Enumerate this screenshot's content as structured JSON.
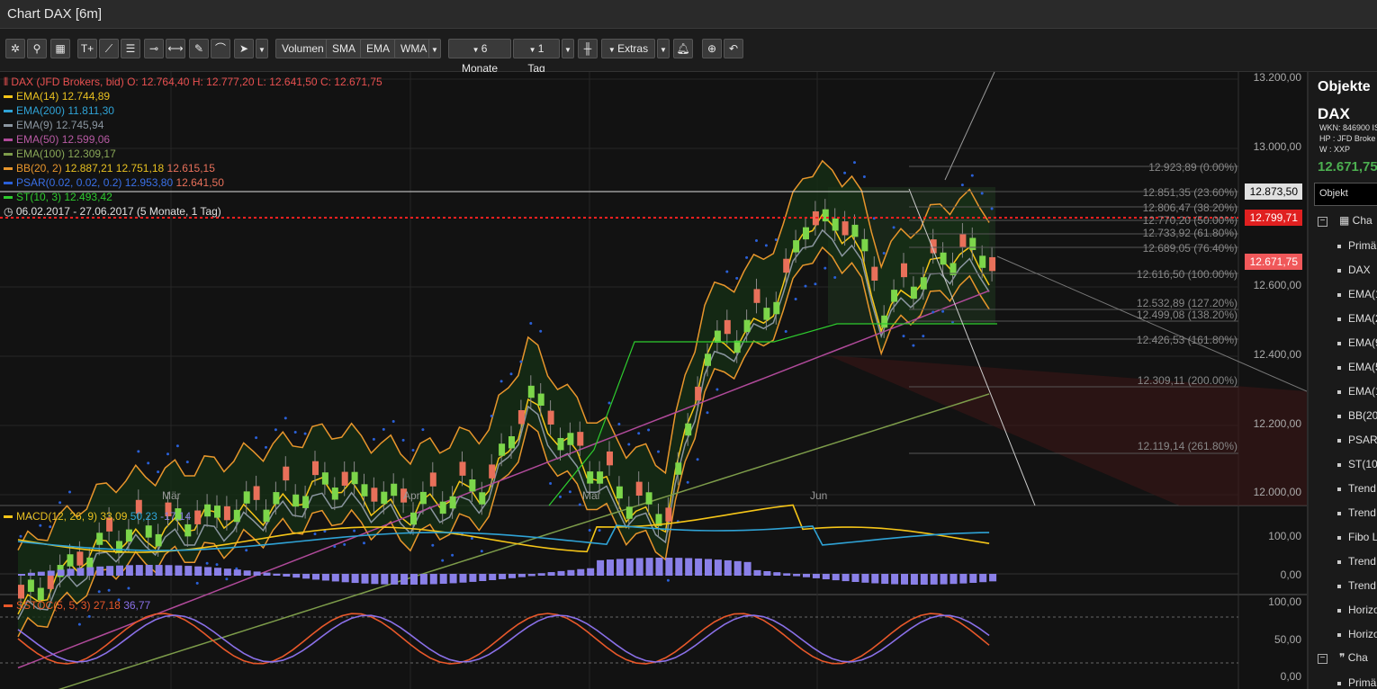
{
  "window": {
    "title": "Chart DAX [6m]"
  },
  "toolbar": {
    "volumen": "Volumen",
    "sma": "SMA",
    "ema": "EMA",
    "wma": "WMA",
    "period": "6 Monate",
    "interval": "1 Tag",
    "extras": "Extras",
    "text_tool": "T+"
  },
  "legend": {
    "main": {
      "label": "DAX (JFD Brokers, bid)",
      "o": "O: 12.764,40",
      "h": "H: 12.777,20",
      "l": "L: 12.641,50",
      "c": "C: 12.671,75"
    },
    "ema14": {
      "label": "EMA(14)",
      "v1": "12.744,89",
      "color": "#f5c518"
    },
    "ema200": {
      "label": "EMA(200)",
      "v1": "11.811,30",
      "color": "#2fa3d6"
    },
    "ema9": {
      "label": "EMA(9)",
      "v1": "12.745,94",
      "color": "#8b96a0"
    },
    "ema50": {
      "label": "EMA(50)",
      "v1": "12.599,06",
      "color": "#b04a9a"
    },
    "ema100": {
      "label": "EMA(100)",
      "v1": "12.309,17",
      "color": "#7d9c4a"
    },
    "bb": {
      "label": "BB(20, 2)",
      "v1": "12.887,21",
      "v2": "12.751,18",
      "v3": "12.615,15",
      "color": "#e8962c"
    },
    "psar": {
      "label": "PSAR(0.02, 0.02, 0.2)",
      "v1": "12.953,80",
      "v2": "12.641,50",
      "color": "#2a60d8"
    },
    "st": {
      "label": "ST(10, 3)",
      "v1": "12.493,42",
      "color": "#2ecc2e"
    },
    "range": "06.02.2017 - 27.06.2017  (5 Monate, 1 Tag)"
  },
  "y_axis": [
    "13.200,00",
    "13.000,00",
    "12.600,00",
    "12.400,00",
    "12.200,00",
    "12.000,00"
  ],
  "x_axis": [
    "Mär",
    "Apr",
    "Mai",
    "Jun"
  ],
  "price_tags": {
    "t1": {
      "text": "12.873,50",
      "bg": "#e0e0e0",
      "fg": "#000"
    },
    "t2": {
      "text": "12.799,71",
      "bg": "#e02020",
      "fg": "#fff"
    },
    "t3": {
      "text": "12.671,75",
      "bg": "#f0585a",
      "fg": "#fff"
    }
  },
  "fib_levels": [
    "12.923,89 (0.00%)",
    "12.851,35 (23.60%)",
    "12.806,47 (38.20%)",
    "12.770,20 (50.00%)",
    "12.733,92 (61.80%)",
    "12.689,05 (76.40%)",
    "12.616,50 (100.00%)",
    "12.532,89 (127.20%)",
    "12.499,08 (138.20%)",
    "12.426,53 (161.80%)",
    "12.309,11 (200.00%)",
    "12.119,14 (261.80%)"
  ],
  "macd": {
    "label": "MACD(12, 26, 9)",
    "v1": "33,09",
    "v2": "50,23",
    "v3": "-17,14",
    "y_axis": [
      "100,00",
      "0,00"
    ]
  },
  "sstoc": {
    "label": "SSTOC(5, 5, 3)",
    "v1": "27,18",
    "v2": "36,77",
    "y_axis": [
      "100,00",
      "50,00",
      "0,00"
    ]
  },
  "panel": {
    "title": "Objekte",
    "symbol": "DAX",
    "wkn": "WKN: 846900 IS",
    "hp": "HP : JFD Broke",
    "w": "W : XXP",
    "price": "12.671,75",
    "select": "Objekt",
    "group1": "Cha",
    "items": [
      "Primä",
      "DAX",
      "EMA(1",
      "EMA(2",
      "EMA(9",
      "EMA(5",
      "EMA(1",
      "BB(20",
      "PSAR",
      "ST(10",
      "Trend",
      "Trend",
      "Fibo L",
      "Trend",
      "Trend",
      "Horizo",
      "Horizo"
    ],
    "group2": "Cha",
    "last_item": "Primä"
  },
  "colors": {
    "up": "#7cd64a",
    "down": "#e8705a",
    "grid": "#262626",
    "dotted_red": "#ff2020"
  }
}
